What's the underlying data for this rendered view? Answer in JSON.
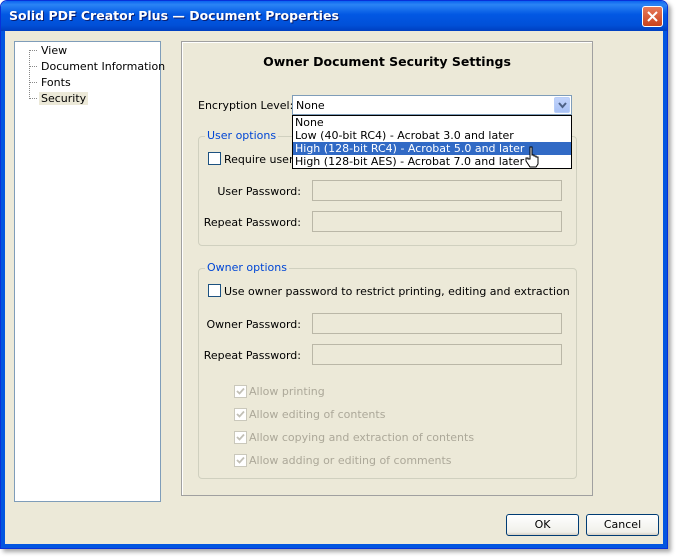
{
  "window": {
    "title": "Solid PDF Creator Plus — Document Properties",
    "close_icon": "close-icon"
  },
  "tree": {
    "items": [
      {
        "label": "View",
        "selected": false
      },
      {
        "label": "Document Information",
        "selected": false
      },
      {
        "label": "Fonts",
        "selected": false
      },
      {
        "label": "Security",
        "selected": true
      }
    ]
  },
  "security": {
    "heading": "Owner Document Security Settings",
    "encryption_label": "Encryption Level:",
    "encryption_value": "None",
    "dropdown_options": [
      "None",
      "Low (40-bit RC4) - Acrobat 3.0 and later",
      "High (128-bit RC4) - Acrobat 5.0 and later",
      "High (128-bit AES) - Acrobat 7.0 and later"
    ],
    "highlighted_option_index": 2
  },
  "user_options": {
    "title": "User options",
    "require_label": "Require user p",
    "require_checked": false,
    "user_password_label": "User Password:",
    "repeat_password_label": "Repeat Password:"
  },
  "owner_options": {
    "title": "Owner options",
    "use_owner_label": "Use owner password to restrict printing, editing and extraction",
    "use_owner_checked": false,
    "owner_password_label": "Owner Password:",
    "repeat_password_label": "Repeat Password:",
    "permissions": [
      {
        "label": "Allow printing",
        "checked": true
      },
      {
        "label": "Allow editing of contents",
        "checked": true
      },
      {
        "label": "Allow copying and extraction of contents",
        "checked": true
      },
      {
        "label": "Allow adding or editing of comments",
        "checked": true
      }
    ]
  },
  "buttons": {
    "ok": "OK",
    "cancel": "Cancel"
  },
  "colors": {
    "titlebar": "#0258e3",
    "highlight": "#316ac5",
    "group_title": "#0046d5",
    "dialog_bg": "#ece9d8"
  }
}
